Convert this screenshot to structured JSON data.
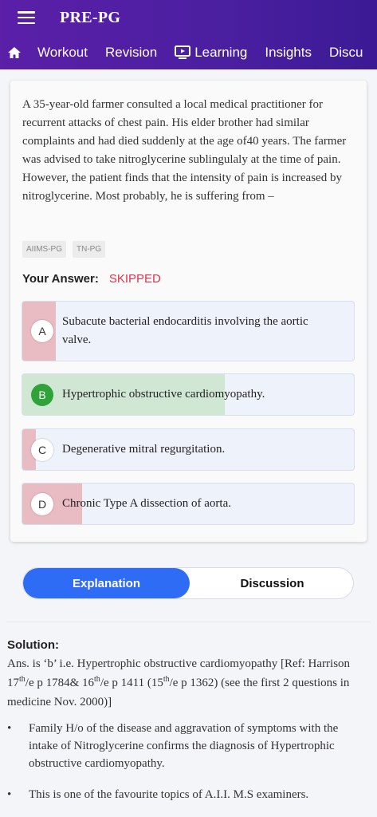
{
  "app": {
    "title": "PRE-PG",
    "tabs": [
      "Workout",
      "Revision",
      "Learning",
      "Insights",
      "Discu"
    ]
  },
  "question": {
    "text": "A 35-year-old farmer consulted a local medical practitioner for recurrent attacks of chest pain. His elder brother had similar complaints and had died suddenly at the age of40 years. The farmer was advised to take nitroglycerine sublingulaly at the time of pain. However, the patient finds that the intensity of pain is increased by nitroglycerine. Most probably, he is suffering from –",
    "tags": [
      "AIIMS-PG",
      "TN-PG"
    ],
    "your_answer_label": "Your Answer:",
    "your_answer_value": "SKIPPED"
  },
  "options": [
    {
      "letter": "A",
      "text": "Subacute bacterial endocarditis involving the aortic valve.",
      "response_share": 0.1
    },
    {
      "letter": "B",
      "text": "Hypertrophic obstructive cardiomyopathy.",
      "response_share": 0.61,
      "correct": true
    },
    {
      "letter": "C",
      "text": "Degenerative mitral regurgitation.",
      "response_share": 0.04
    },
    {
      "letter": "D",
      "text": "Chronic Type A dissection of aorta.",
      "response_share": 0.18
    }
  ],
  "colors": {
    "header": "#4a1fa0",
    "correct_fill": "#cfe7d3",
    "wrong_fill": "#e9bcc4",
    "correct_circle": "#2fa33a",
    "skipped": "#e0334b",
    "toggle_active": "#2f6cf5"
  },
  "toggle": {
    "explanation": "Explanation",
    "discussion": "Discussion"
  },
  "solution": {
    "title": "Solution:",
    "p1": "Ans. is ‘b’ i.e. Hypertrophic obstructive cardiomyopathy [Ref: Harrison 17",
    "sup1": "th",
    "p2": "/e p 1784& 16",
    "sup2": "th",
    "p3": "/e p 1411 (15",
    "sup3": "th",
    "p4": "/e p 1362) (see the first 2 questions in medicine Nov. 2000)]",
    "bullets": [
      "Family H/o of the disease and aggravation of symptoms with the intake of Nitroglycerine confirms the diagnosis of Hypertrophic obstructive cardiomyopathy.",
      "This is one of the favourite topics of A.I.I. M.S examiners."
    ]
  }
}
